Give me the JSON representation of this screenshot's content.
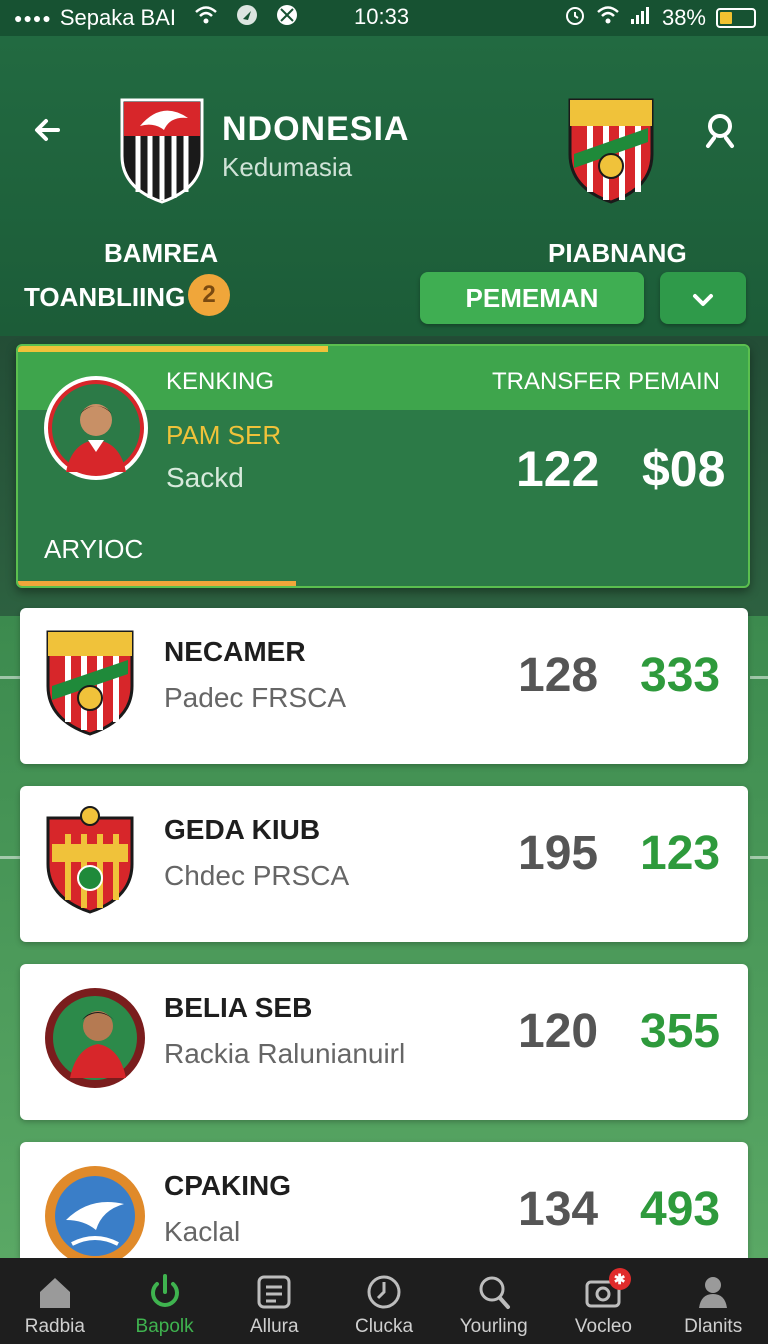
{
  "status_bar": {
    "carrier": "Sepaka BAI",
    "time": "10:33",
    "battery": "38%"
  },
  "header": {
    "title": "NDONESIA",
    "subtitle": "Kedumasia",
    "team_left": "BAMREA",
    "team_right": "PIABNANG",
    "rank_label": "TOANBLIING",
    "rank_badge": "2",
    "pill_label": "PEMEMAN"
  },
  "featured": {
    "header_left": "KENKING",
    "header_right": "TRANSFER PEMAIN",
    "player_name": "PAM SER",
    "player_sub": "Sackd",
    "value1": "122",
    "value2": "$08",
    "footer": "ARYIOC"
  },
  "players": [
    {
      "name": "NECAMER",
      "sub": "Padec FRSCA",
      "num1": "128",
      "num2": "333"
    },
    {
      "name": "GEDA KIUB",
      "sub": "Chdec PRSCA",
      "num1": "195",
      "num2": "123"
    },
    {
      "name": "BELIA SEB",
      "sub": "Rackia Ralunianuirl",
      "num1": "120",
      "num2": "355"
    },
    {
      "name": "CPAKING",
      "sub": "Kaclal",
      "num1": "134",
      "num2": "493"
    }
  ],
  "nav": [
    {
      "label": "Radbia",
      "icon": "home-icon"
    },
    {
      "label": "Bapolk",
      "icon": "power-icon"
    },
    {
      "label": "Allura",
      "icon": "grid-icon"
    },
    {
      "label": "Clucka",
      "icon": "clock-icon"
    },
    {
      "label": "Yourling",
      "icon": "search-icon"
    },
    {
      "label": "Vocleo",
      "icon": "camera-icon"
    },
    {
      "label": "Dlanits",
      "icon": "person-icon"
    }
  ],
  "colors": {
    "primary_green": "#1f5a3a",
    "accent_green": "#3fae52",
    "gold": "#f0c23a",
    "value_green": "#2e9a3c"
  }
}
